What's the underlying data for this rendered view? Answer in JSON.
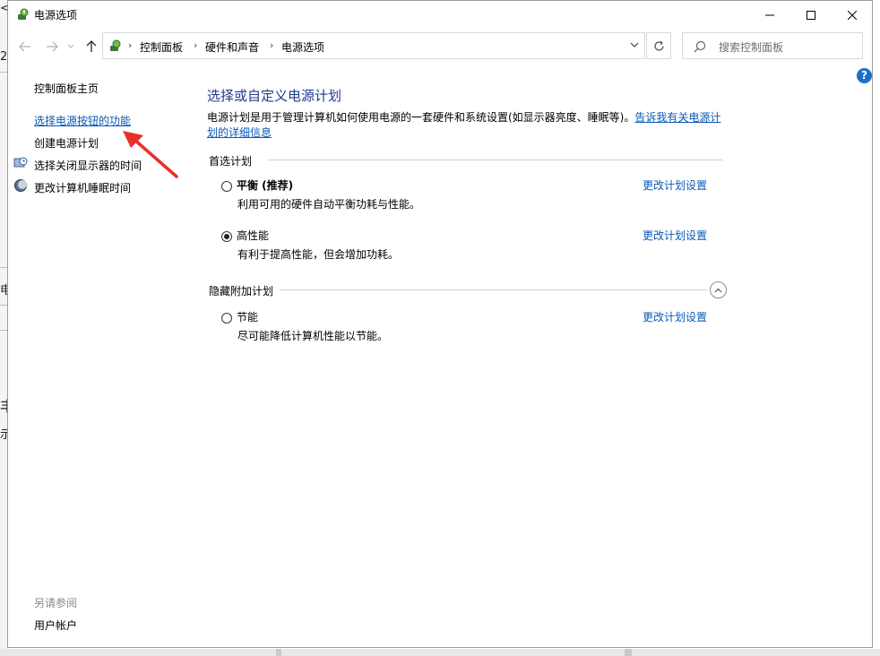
{
  "window": {
    "title": "电源选项"
  },
  "address": {
    "crumbs": [
      "控制面板",
      "硬件和声音",
      "电源选项"
    ]
  },
  "search": {
    "placeholder": "搜索控制面板"
  },
  "help": {
    "label": "?"
  },
  "sidebar": {
    "items": [
      {
        "label": "控制面板主页"
      },
      {
        "label": "选择电源按钮的功能"
      },
      {
        "label": "创建电源计划"
      },
      {
        "label": "选择关闭显示器的时间"
      },
      {
        "label": "更改计算机睡眠时间"
      }
    ],
    "see_also": "另请参阅",
    "see_also_items": [
      {
        "label": "用户帐户"
      }
    ]
  },
  "main": {
    "title": "选择或自定义电源计划",
    "description": "电源计划是用于管理计算机如何使用电源的一套硬件和系统设置(如显示器亮度、睡眠等)。",
    "description_link": "告诉我有关电源计划的详细信息",
    "preferred_label": "首选计划",
    "hidden_label": "隐藏附加计划",
    "plans": [
      {
        "name": "平衡 (推荐)",
        "desc": "利用可用的硬件自动平衡功耗与性能。",
        "link": "更改计划设置",
        "selected": false
      },
      {
        "name": "高性能",
        "desc": "有利于提高性能，但会增加功耗。",
        "link": "更改计划设置",
        "selected": true
      },
      {
        "name": "节能",
        "desc": "尽可能降低计算机性能以节能。",
        "link": "更改计划设置",
        "selected": false
      }
    ]
  },
  "background_fragments": [
    "<",
    "2",
    "电",
    "丰",
    "示"
  ],
  "colors": {
    "link": "#0a58b6",
    "title": "#1e3a8a",
    "help": "#1c6fc7",
    "arrow": "#e8302a"
  }
}
